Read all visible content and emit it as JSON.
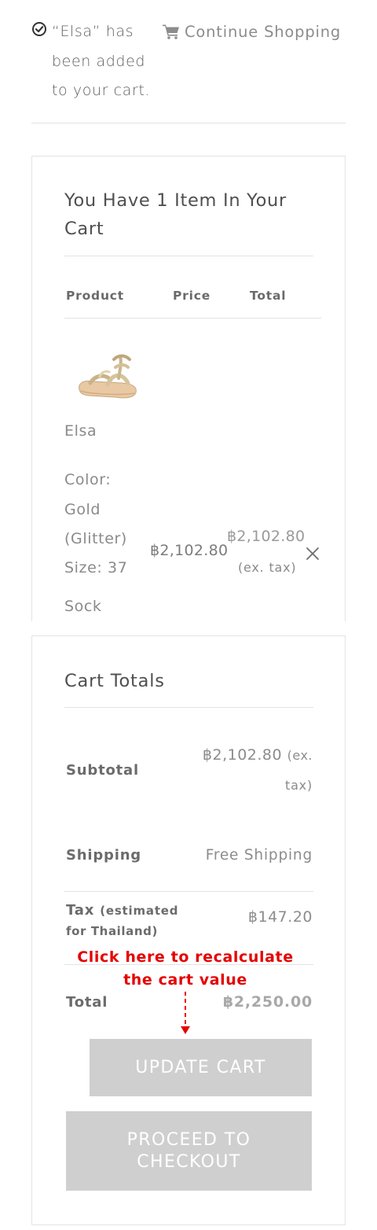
{
  "notice": {
    "check_icon": "check-circle-icon",
    "message_lines": [
      "“Elsa” has",
      "been added",
      "to your cart."
    ],
    "continue_icon": "shopping-cart-icon",
    "continue_label": "Continue Shopping"
  },
  "cart": {
    "title_lines": [
      "You Have 1 Item In Your",
      "Cart"
    ],
    "columns": {
      "product": "Product",
      "price": "Price",
      "total": "Total"
    },
    "item": {
      "image": "gold-glitter-sandal",
      "name": "Elsa",
      "color_lines": [
        "Color:",
        "Gold",
        "(Glitter)"
      ],
      "size": "Size: 37",
      "extra": "Sock",
      "price": "฿2,102.80",
      "total": "฿2,102.80",
      "total_note": "(ex. tax)",
      "remove_icon": "close-icon"
    }
  },
  "totals": {
    "title": "Cart Totals",
    "subtotal": {
      "label": "Subtotal",
      "value": "฿2,102.80",
      "note_1": "(ex.",
      "note_2": "tax)"
    },
    "shipping": {
      "label": "Shipping",
      "value": "Free Shipping"
    },
    "tax": {
      "label": "Tax",
      "label_suffix": "(estimated",
      "note": "for Thailand)",
      "value": "฿147.20"
    },
    "total": {
      "label": "Total",
      "value": "฿2,250.00"
    },
    "callout_lines": [
      "Click here to recalculate",
      "the cart value"
    ],
    "update_label": "UPDATE CART",
    "checkout_label": "PROCEED TO CHECKOUT"
  },
  "colors": {
    "callout": "#e60000",
    "button_bg": "#cfcfcf",
    "border": "#e3e3e3"
  }
}
